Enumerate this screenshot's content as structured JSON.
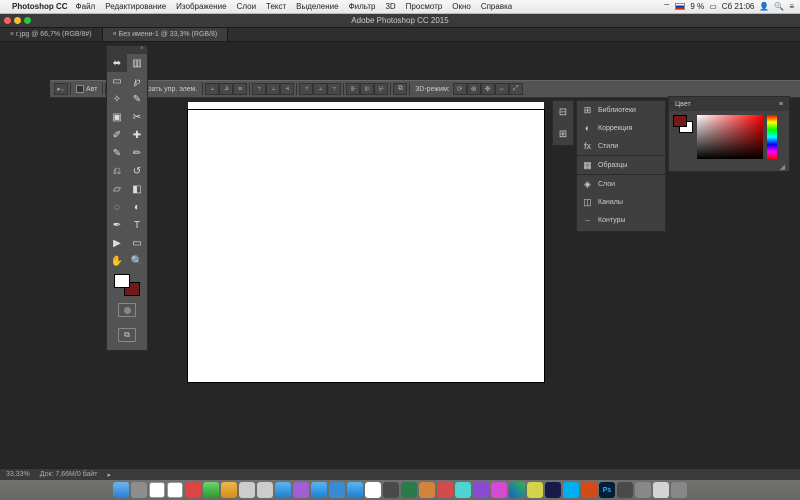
{
  "menubar": {
    "app": "Photoshop CC",
    "items": [
      "Файл",
      "Редактирование",
      "Изображение",
      "Слои",
      "Текст",
      "Выделение",
      "Фильтр",
      "3D",
      "Просмотр",
      "Окно",
      "Справка"
    ],
    "battery": "9 %",
    "clock": "Сб 21:06",
    "user_icon": "👤"
  },
  "window_title": "Adobe Photoshop CC 2015",
  "doc_tabs": [
    {
      "label": "r.jpg @ 66,7% (RGB/8#)",
      "active": false
    },
    {
      "label": "Без имени-1 @ 33,3% (RGB/8)",
      "active": true
    }
  ],
  "options": {
    "auto_label": "Авт",
    "show_controls": "Показать упр. элем.",
    "mode_label": "3D-режим:"
  },
  "tools": [
    {
      "n": "move-tool",
      "g": "⬌"
    },
    {
      "n": "artboard-tool",
      "g": "▥"
    },
    {
      "n": "marquee-tool",
      "g": "▭"
    },
    {
      "n": "lasso-tool",
      "g": "℘"
    },
    {
      "n": "magic-wand-tool",
      "g": "✧"
    },
    {
      "n": "quick-select-tool",
      "g": "✎"
    },
    {
      "n": "crop-tool",
      "g": "▣"
    },
    {
      "n": "slice-tool",
      "g": "✂"
    },
    {
      "n": "eyedropper-tool",
      "g": "✐"
    },
    {
      "n": "healing-tool",
      "g": "✚"
    },
    {
      "n": "brush-tool",
      "g": "✎"
    },
    {
      "n": "pencil-tool",
      "g": "✏"
    },
    {
      "n": "clone-tool",
      "g": "⎌"
    },
    {
      "n": "history-brush-tool",
      "g": "↺"
    },
    {
      "n": "eraser-tool",
      "g": "▱"
    },
    {
      "n": "gradient-tool",
      "g": "◧"
    },
    {
      "n": "blur-tool",
      "g": "◌"
    },
    {
      "n": "dodge-tool",
      "g": "◐"
    },
    {
      "n": "pen-tool",
      "g": "✒"
    },
    {
      "n": "type-tool",
      "g": "T"
    },
    {
      "n": "path-select-tool",
      "g": "▶"
    },
    {
      "n": "shape-tool",
      "g": "▭"
    },
    {
      "n": "hand-tool",
      "g": "✋"
    },
    {
      "n": "zoom-tool",
      "g": "🔍"
    }
  ],
  "panel_groups": [
    [
      {
        "n": "libraries",
        "l": "Библиотеки",
        "i": "⊞"
      },
      {
        "n": "adjustments",
        "l": "Коррекция",
        "i": "◐"
      },
      {
        "n": "styles",
        "l": "Стили",
        "i": "fx"
      }
    ],
    [
      {
        "n": "swatches",
        "l": "Образцы",
        "i": "▦"
      }
    ],
    [
      {
        "n": "layers",
        "l": "Слои",
        "i": "◈"
      },
      {
        "n": "channels",
        "l": "Каналы",
        "i": "◫"
      },
      {
        "n": "paths",
        "l": "Контуры",
        "i": "⎯"
      }
    ]
  ],
  "color_panel": {
    "title": "Цвет"
  },
  "status": {
    "zoom": "33,33%",
    "doc_size": "Док: 7,66М/0 байт"
  },
  "dock_styles": [
    "dk0",
    "dk1",
    "dk2",
    "dk2",
    "dk3",
    "dk4",
    "dk5",
    "dk6",
    "dk6",
    "dk7",
    "dk8",
    "dk7",
    "dk9",
    "dk7",
    "dk10",
    "dk11",
    "dk12",
    "dk13",
    "dk14",
    "dk15",
    "dk16",
    "dk17",
    "dk18",
    "dk19",
    "dk20",
    "dk21",
    "dk22",
    "dk23",
    "dk24",
    "dk26",
    "dk25",
    "dk26"
  ]
}
